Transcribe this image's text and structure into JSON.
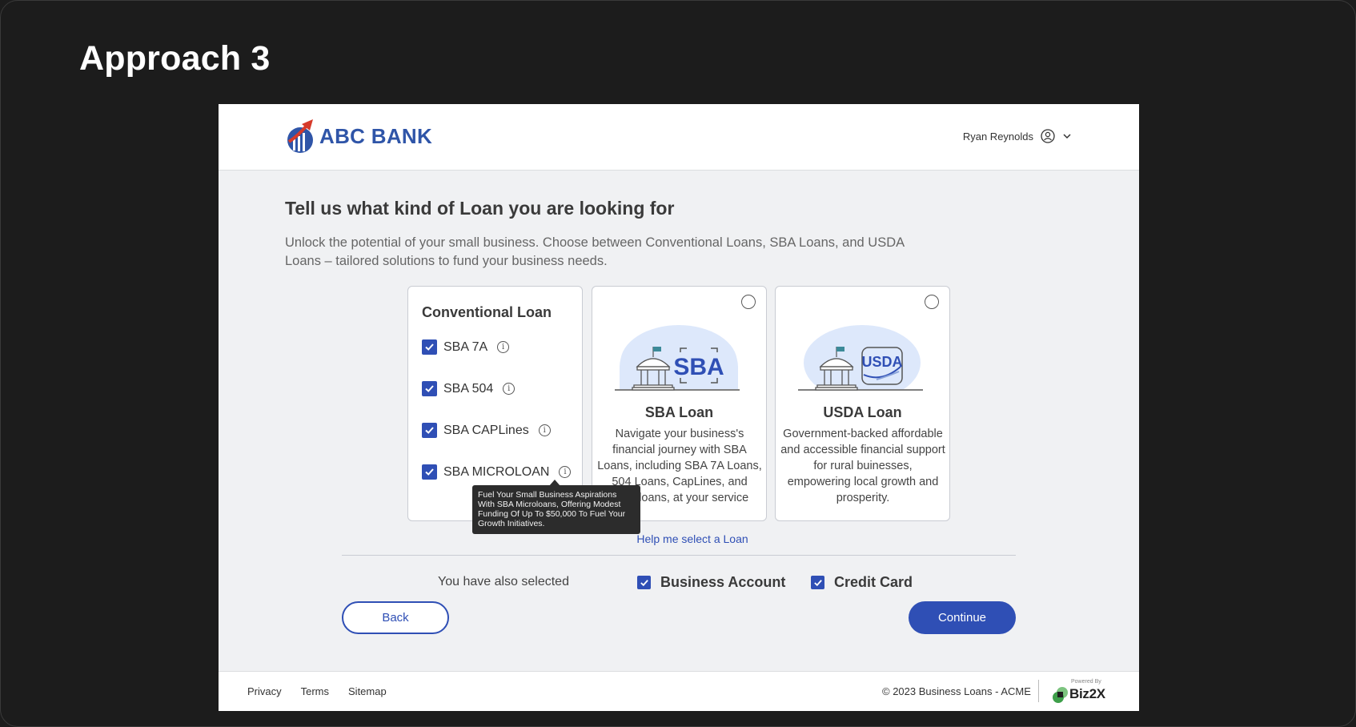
{
  "approach_title": "Approach 3",
  "header": {
    "brand": "ABC BANK",
    "user_name": "Ryan Reynolds"
  },
  "main": {
    "heading": "Tell us what kind of Loan you are looking for",
    "subtext": "Unlock the potential of your small business. Choose between Conventional Loans, SBA Loans, and USDA Loans – tailored solutions to fund your business needs.",
    "conventional": {
      "title": "Conventional Loan",
      "options": [
        {
          "label": "SBA 7A",
          "checked": true
        },
        {
          "label": "SBA 504",
          "checked": true
        },
        {
          "label": "SBA CAPLines",
          "checked": true
        },
        {
          "label": "SBA MICROLOAN",
          "checked": true
        }
      ]
    },
    "sba": {
      "title": "SBA Loan",
      "desc": "Navigate your business's financial journey with SBA Loans, including SBA 7A Loans, 504 Loans, CapLines, and Microloans, at your service",
      "illustration_text": "SBA"
    },
    "usda": {
      "title": "USDA Loan",
      "desc": "Government-backed affordable and accessible financial support for rural buinesses, empowering local growth and prosperity.",
      "illustration_text": "USDA"
    },
    "tooltip": "Fuel Your Small Business Aspirations With SBA Microloans, Offering Modest Funding Of Up To $50,000 To Fuel Your Growth Initiatives.",
    "help_link": "Help me select a Loan",
    "also_selected_label": "You have also selected",
    "also_selected": [
      {
        "label": "Business Account",
        "checked": true
      },
      {
        "label": "Credit Card",
        "checked": true
      }
    ],
    "back_label": "Back",
    "continue_label": "Continue"
  },
  "footer": {
    "links": [
      "Privacy",
      "Terms",
      "Sitemap"
    ],
    "copyright": "© 2023 Business Loans - ACME",
    "powered_by": "Powered By",
    "powered_name": "Biz2X"
  },
  "colors": {
    "primary": "#2f4fb5",
    "logo_blue": "#2f55a8",
    "logo_red": "#d63a2a",
    "page_bg": "#1c1c1c",
    "frame_bg": "#f0f1f3"
  }
}
